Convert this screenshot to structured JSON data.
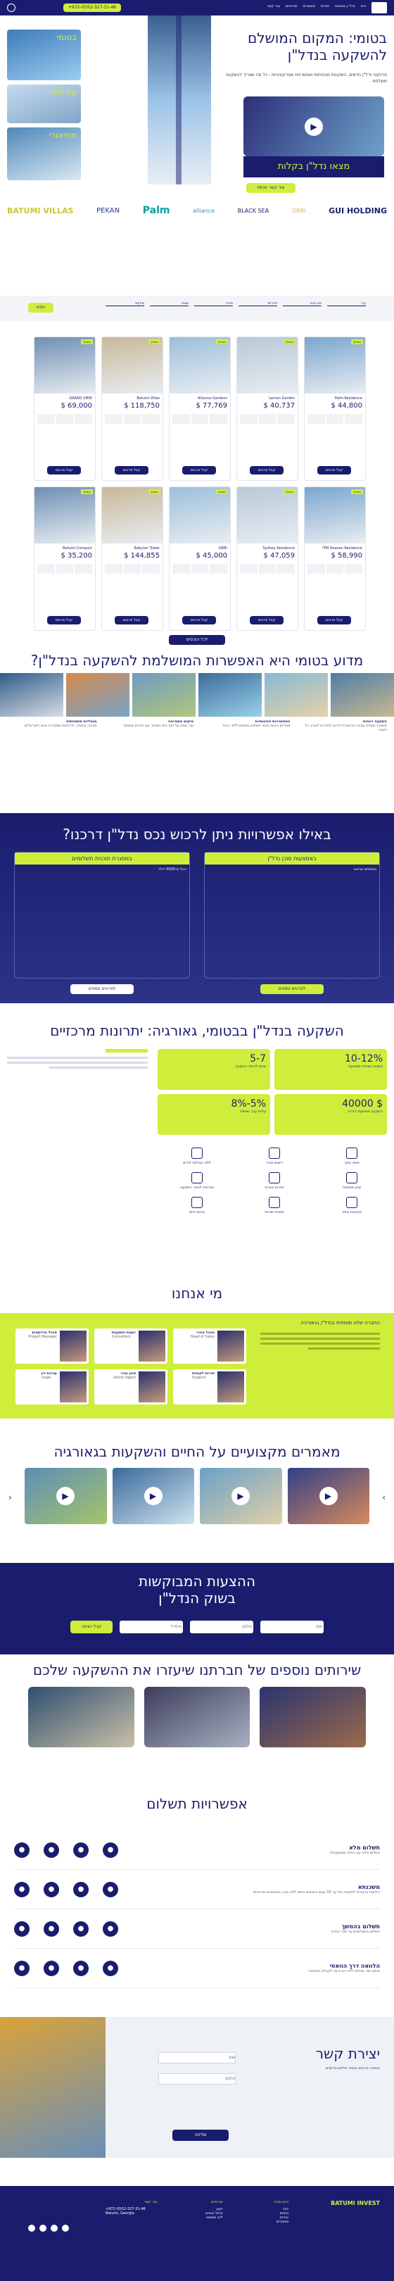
{
  "header": {
    "phone": "+972-(0)52-327-31-46",
    "nav": [
      "בית",
      "נדל״ן בבטומי",
      "אודות",
      "מאמרים",
      "שירותים",
      "צור קשר"
    ],
    "logo_text": "BATUMI"
  },
  "hero": {
    "title": "בטומי: המקום המושלם להשקעה בנדל\"ן",
    "subtitle": "פרויקטי נדל\"ן חדשים, השקעות מבטיחות ואפשרויות אטרקטיביות - כל מה שצריך להשקעה מוצלחת",
    "video_caption": "מצאו נדל\"ן בקלות",
    "search_button": "צור קשר עכשיו",
    "city_tiles": [
      "בטומי",
      "טביליסי",
      "מתיאורי"
    ]
  },
  "partners": [
    "BATUMI VILLAS",
    "ORBI",
    "alliance",
    "BLACK SEA",
    "Palm",
    "PEKAN",
    "GUI HOLDING"
  ],
  "search_bar": {
    "fields": [
      "עיר",
      "סוג נכס",
      "חדרים",
      "מחיר",
      "שטח",
      "מיקום"
    ],
    "button": "חפש"
  },
  "listings": [
    {
      "name": "Palm Residence",
      "price": "$ 44,800",
      "cta": "קבל פרטים",
      "badge": "מומלץ"
    },
    {
      "name": "Lemon Garden",
      "price": "$ 40,737",
      "cta": "קבל פרטים",
      "badge": "מומלץ"
    },
    {
      "name": "Alliance Gardens",
      "price": "$ 77,769",
      "cta": "קבל פרטים",
      "badge": "מומלץ"
    },
    {
      "name": "Batumi Villas",
      "price": "$ 118,750",
      "cta": "קבל פרטים",
      "badge": "מומלץ"
    },
    {
      "name": "GRAND VIEW",
      "price": "$ 69,000",
      "cta": "קבל פרטים",
      "badge": "מומלץ"
    },
    {
      "name": "ITM Heaven Residence",
      "price": "$ 58,990",
      "cta": "קבל פרטים",
      "badge": "מומלץ"
    },
    {
      "name": "Sydney Residence",
      "price": "$ 47,059",
      "cta": "קבל פרטים",
      "badge": "מומלץ"
    },
    {
      "name": "ORBI",
      "price": "$ 45,000",
      "cta": "קבל פרטים",
      "badge": "מומלץ"
    },
    {
      "name": "Babylon Tower",
      "price": "$ 144,855",
      "cta": "קבל פרטים",
      "badge": "מומלץ"
    },
    {
      "name": "Batumi Compact",
      "price": "$ 35,200",
      "cta": "קבל פרטים",
      "badge": "מומלץ"
    }
  ],
  "more_button": "לכל הנכסים",
  "why": {
    "title": "מדוע בטומי היא האפשרות המושלמת להשקעה בנדל\"ן?",
    "cards": [
      {
        "title": "השקעה רווחית",
        "text": "תשואה שנתית גבוהה מהשכרת דירות לתיירים לאורך כל השנה"
      },
      {
        "title": "האפשרויות הפיננסיות",
        "text": "מחירים נוחים ותנאי תשלום גמישים ללא ריבית"
      },
      {
        "title": "מיקום אסטרטגי",
        "text": "עיר נופש על חוף הים השחור עם תיירות צומחת"
      },
      {
        "title": "מנטליות משפחתית",
        "text": "סביבה בטוחה, ידידותית ומסבירת פנים לישראלים"
      }
    ]
  },
  "options": {
    "title": "באילו אפשרויות ניתן לרכוש נכס נדל\"ן דרכנו?",
    "cards": [
      {
        "title": "באמצעות סוכן נדל\"ן",
        "subtitle": "בתשלום מראש"
      },
      {
        "title": "במסגרת תוכנית תשלומים",
        "subtitle": "החל מ-5000 דולר"
      }
    ],
    "buttons": [
      "לפרטים נוספים",
      "לפרטים נוספים"
    ]
  },
  "benefits": {
    "title": "השקעה בנדל\"ן בבטומי, גאורגיה: יתרונות מרכזיים",
    "stats": [
      {
        "value": "10-12%",
        "label": "תשואה שנתית ממוצעת"
      },
      {
        "value": "5-7",
        "label": "שנים להחזר השקעה"
      },
      {
        "value": "$ 40000",
        "label": "השקעה ממוצעת בדירה"
      },
      {
        "value": "5%-8%",
        "label": "עליית ערך שנתית"
      }
    ],
    "features": [
      "מיסוי נמוך",
      "רישום מהיר",
      "ללא הגבלות לזרים",
      "שוק מתפתח",
      "תיירות גוברת",
      "אזרחות לאחר השקעה",
      "בנקאות נוחה",
      "טיסות ישירות",
      "איכות חיים"
    ]
  },
  "about": {
    "title": "מי אנחנו",
    "subtitle": "החברה שלנו מומחית בנדל\"ן בגאורגיה",
    "team": [
      {
        "name": "מנהל אזורי",
        "role": "Head of Sales"
      },
      {
        "name": "יועצת השקעות",
        "role": "Consultant"
      },
      {
        "name": "מנהל פרויקטים",
        "role": "Project Manager"
      },
      {
        "name": "שירות לקוחות",
        "role": "Support"
      },
      {
        "name": "סוכן בכיר",
        "role": "Senior Agent"
      },
      {
        "name": "עורכת דין",
        "role": "Legal"
      }
    ]
  },
  "articles": {
    "title": "מאמרים מקצועיים על החיים והשקעות בגאורגיה"
  },
  "offers": {
    "title": "ההצעות המבוקשות בשוק הנדל\"ן",
    "name_ph": "שם",
    "phone_ph": "טלפון",
    "email_ph": "אימייל",
    "button": "קבל הצעה"
  },
  "services": {
    "title": "שירותים נוספים של חברתנו שיעזרו את ההשקעה שלכם"
  },
  "payment": {
    "title": "אפשרויות תשלום",
    "rows": [
      {
        "title": "תשלום מלא",
        "text": "תשלום מלא עם הנחה משמעותית"
      },
      {
        "title": "משכנתא",
        "text": "הלוואה בנקאית לתקופה של עד 15 שנים בתנאים נוחים ללא צורך במסמכים מורכבים"
      },
      {
        "title": "תשלום בהמשך",
        "text": "תשלום בתשלומים עד סוף הבנייה"
      },
      {
        "title": "הלוואה דרך הוואסי",
        "text": "מימון ישיר מהיזם ללא ריבית עד לקבלת המפתח"
      }
    ]
  },
  "contact": {
    "title": "יצירת קשר",
    "subtitle": "השאירו פרטים ונחזור אליכם בהקדם",
    "name_ph": "שם",
    "phone_ph": "טלפון",
    "button": "שליחה"
  },
  "footer": {
    "columns": [
      {
        "heading": "ניווט מהיר",
        "items": [
          "בית",
          "נכסים",
          "אודות",
          "מאמרים"
        ]
      },
      {
        "heading": "שירותים",
        "items": [
          "ייעוץ",
          "ניהול נכסים",
          "ליווי משפטי"
        ]
      },
      {
        "heading": "צור קשר",
        "items": [
          "+972-(0)52-327-31-46",
          "Batumi, Georgia"
        ]
      }
    ],
    "logo_text": "BATUMI INVEST"
  }
}
